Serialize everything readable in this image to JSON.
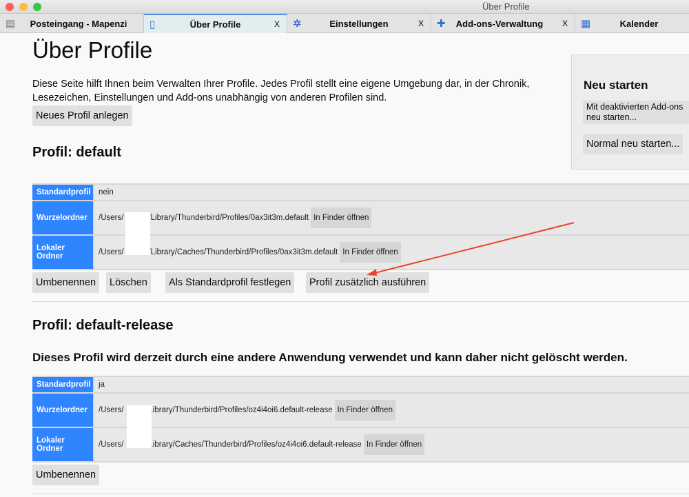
{
  "window": {
    "title": "Über Profile"
  },
  "tabs": [
    {
      "label": "Posteingang - Mapenzi",
      "icon": "inbox-icon"
    },
    {
      "label": "Über Profile",
      "icon": "document-icon",
      "close": "X",
      "active": true
    },
    {
      "label": "Einstellungen",
      "icon": "gear-icon",
      "close": "X"
    },
    {
      "label": "Add-ons-Verwaltung",
      "icon": "puzzle-icon",
      "close": "X"
    },
    {
      "label": "Kalender",
      "icon": "calendar-icon"
    }
  ],
  "page": {
    "title": "Über Profile",
    "intro": "Diese Seite hilft Ihnen beim Verwalten Ihrer Profile. Jedes Profil stellt eine eigene Umgebung dar, in der Chronik, Lesezeichen, Einstellungen und Add-ons unabhängig von anderen Profilen sind.",
    "new_profile": "Neues Profil anlegen"
  },
  "restart": {
    "title": "Neu starten",
    "safe_mode": "Mit deaktivierten Add-ons neu starten...",
    "normal": "Normal neu starten..."
  },
  "labels": {
    "default": "Standardprofil",
    "root": "Wurzelordner",
    "local": "Lokaler Ordner",
    "open": "In Finder öffnen",
    "users": "/Users/"
  },
  "profiles": [
    {
      "title": "Profil: default",
      "default": "nein",
      "root_path": "/Library/Thunderbird/Profiles/0ax3it3m.default",
      "local_path": "/Library/Caches/Thunderbird/Profiles/0ax3it3m.default",
      "buttons": [
        "Umbenennen",
        "Löschen",
        "Als Standardprofil festlegen",
        "Profil zusätzlich ausführen"
      ]
    },
    {
      "title": "Profil: default-release",
      "notice": "Dieses Profil wird derzeit durch eine andere Anwendung verwendet und kann daher nicht gelöscht werden.",
      "default": "ja",
      "root_path": "Library/Thunderbird/Profiles/oz4i4oi6.default-release",
      "local_path": "Library/Caches/Thunderbird/Profiles/oz4i4oi6.default-release",
      "buttons": [
        "Umbenennen"
      ]
    }
  ],
  "colors": {
    "header_cell": "#2f84ff",
    "annotation_arrow": "#e8462b"
  }
}
